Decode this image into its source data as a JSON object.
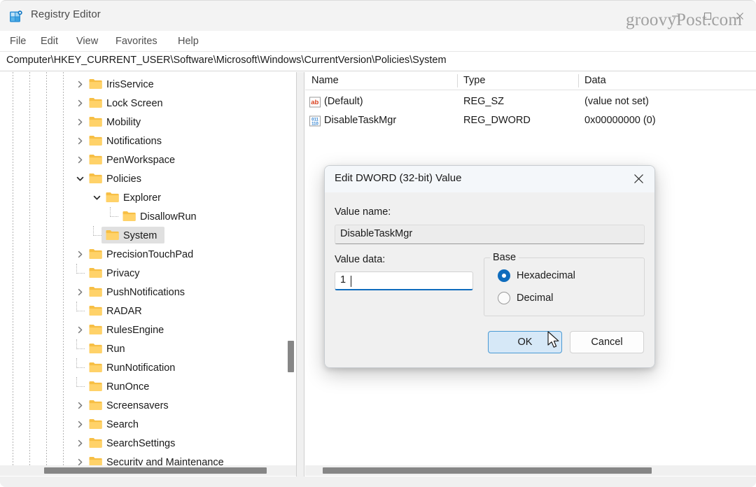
{
  "window": {
    "title": "Registry Editor",
    "icon": "registry-editor-icon",
    "watermark": "groovyPost.com",
    "controls": {
      "minimize": "minimize-icon",
      "maximize": "maximize-icon",
      "close": "close-icon"
    }
  },
  "menu": {
    "items": [
      "File",
      "Edit",
      "View",
      "Favorites",
      "Help"
    ]
  },
  "address": {
    "path": "Computer\\HKEY_CURRENT_USER\\Software\\Microsoft\\Windows\\CurrentVersion\\Policies\\System"
  },
  "tree": {
    "nodes": [
      {
        "label": "IrisService",
        "depth": 1,
        "chevron": "right",
        "selected": false
      },
      {
        "label": "Lock Screen",
        "depth": 1,
        "chevron": "right",
        "selected": false
      },
      {
        "label": "Mobility",
        "depth": 1,
        "chevron": "right",
        "selected": false
      },
      {
        "label": "Notifications",
        "depth": 1,
        "chevron": "right",
        "selected": false
      },
      {
        "label": "PenWorkspace",
        "depth": 1,
        "chevron": "right",
        "selected": false
      },
      {
        "label": "Policies",
        "depth": 1,
        "chevron": "down",
        "selected": false
      },
      {
        "label": "Explorer",
        "depth": 2,
        "chevron": "down",
        "selected": false
      },
      {
        "label": "DisallowRun",
        "depth": 3,
        "chevron": "none",
        "selected": false
      },
      {
        "label": "System",
        "depth": 2,
        "chevron": "none",
        "selected": true
      },
      {
        "label": "PrecisionTouchPad",
        "depth": 1,
        "chevron": "right",
        "selected": false
      },
      {
        "label": "Privacy",
        "depth": 1,
        "chevron": "none",
        "selected": false
      },
      {
        "label": "PushNotifications",
        "depth": 1,
        "chevron": "right",
        "selected": false
      },
      {
        "label": "RADAR",
        "depth": 1,
        "chevron": "none",
        "selected": false
      },
      {
        "label": "RulesEngine",
        "depth": 1,
        "chevron": "right",
        "selected": false
      },
      {
        "label": "Run",
        "depth": 1,
        "chevron": "none",
        "selected": false
      },
      {
        "label": "RunNotification",
        "depth": 1,
        "chevron": "none",
        "selected": false
      },
      {
        "label": "RunOnce",
        "depth": 1,
        "chevron": "none",
        "selected": false
      },
      {
        "label": "Screensavers",
        "depth": 1,
        "chevron": "right",
        "selected": false
      },
      {
        "label": "Search",
        "depth": 1,
        "chevron": "right",
        "selected": false
      },
      {
        "label": "SearchSettings",
        "depth": 1,
        "chevron": "right",
        "selected": false
      },
      {
        "label": "Security and Maintenance",
        "depth": 1,
        "chevron": "right",
        "selected": false
      }
    ]
  },
  "list": {
    "columns": [
      "Name",
      "Type",
      "Data"
    ],
    "rows": [
      {
        "icon": "string-value-icon",
        "name": "(Default)",
        "type": "REG_SZ",
        "data": "(value not set)"
      },
      {
        "icon": "dword-value-icon",
        "name": "DisableTaskMgr",
        "type": "REG_DWORD",
        "data": "0x00000000 (0)"
      }
    ]
  },
  "dialog": {
    "title": "Edit DWORD (32-bit) Value",
    "close_icon": "close-icon",
    "value_name_label": "Value name:",
    "value_name": "DisableTaskMgr",
    "value_data_label": "Value data:",
    "value_data": "1",
    "base_label": "Base",
    "base_options": [
      {
        "label": "Hexadecimal",
        "selected": true
      },
      {
        "label": "Decimal",
        "selected": false
      }
    ],
    "ok_label": "OK",
    "cancel_label": "Cancel"
  },
  "colors": {
    "accent": "#0f6cbd",
    "folder": "#ffc societ"
  }
}
